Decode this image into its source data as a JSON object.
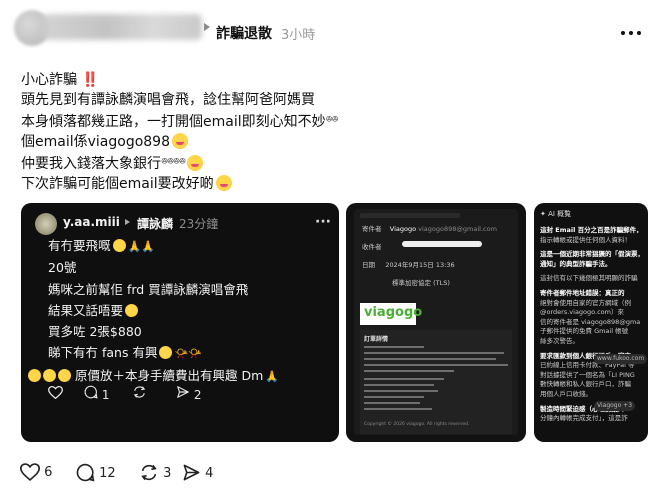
{
  "post": {
    "topic": "詐騙退散",
    "time": "3小時",
    "lines": [
      "小心詐騙",
      "頭先見到有譚詠麟演唱會飛，諗住幫阿爸阿媽買",
      "本身傾落都幾正路，一打開個email即刻心知不妙",
      "個email係viagogo898",
      "仲要我入錢落大象銀行",
      "下次詐騙可能個email要改好啲"
    ],
    "bangbang": "‼️"
  },
  "quoted_post": {
    "username": "y.aa.miii",
    "topic": "譚詠麟",
    "time": "23分鐘",
    "lines": [
      "有冇要飛嘅",
      "20號",
      "媽咪之前幫佢 frd 買譚詠麟演唱會飛",
      "結果又話唔要",
      "買多咗 2張$880",
      "睇下有冇 fans 有興",
      "原價放＋本身手續費出有興趣 Dm"
    ],
    "counts": {
      "comments": "1",
      "reposts": "",
      "shares": "2"
    }
  },
  "email_card": {
    "rows": [
      {
        "label": "寄件者",
        "value": "Viagogo",
        "detail": "viagogo898@gmail.com"
      },
      {
        "label": "收件者",
        "value": ""
      },
      {
        "label": "日期",
        "value": "2024年9月15日 13:36"
      },
      {
        "label": "",
        "value": "標準加密協定 (TLS)"
      }
    ],
    "logo": "viagogo",
    "doc_title": "訂單詳情",
    "doc_footer": "Copyright © 2026 viagogo. All rights reserved."
  },
  "ai_card": {
    "title": "AI 概覧",
    "lines": [
      "這封 Email 百分之百是詐騙郵件，",
      "指示轉帳或提供任何個人資料！",
      "",
      "這是一個近期非常猖獗的「假演票，",
      "通知」的典型詐騙手法。",
      "",
      "這封信有以下幾個極其明顯的詐騙",
      "",
      "寄件者郵件地址錯誤：真正的",
      "絕對會使用自家的官方網域（例",
      "@orders.viagogo.com）來",
      "信的寄件者是 viagogo898@gma",
      "子郵件提供的免費 Gmail 帳號",
      "絲多次警告。",
      "",
      "要求匯款到個人銀行帳戶：官方",
      "已約線上信用卡付款、PayPal 等",
      "對話據提供了一個名為「LI PING",
      "數快轉帳和私人銀行戶口，詐騙",
      "用個人戶口收錢。",
      "",
      "製造時間緊迫感（心理操縱）：",
      "分鐘內轉帳完成支付」，這是詐"
    ],
    "chips": [
      "www.fukoo.com",
      "Viagogo +3"
    ]
  },
  "actions": {
    "likes": "6",
    "comments": "12",
    "reposts": "3",
    "shares": "4"
  }
}
